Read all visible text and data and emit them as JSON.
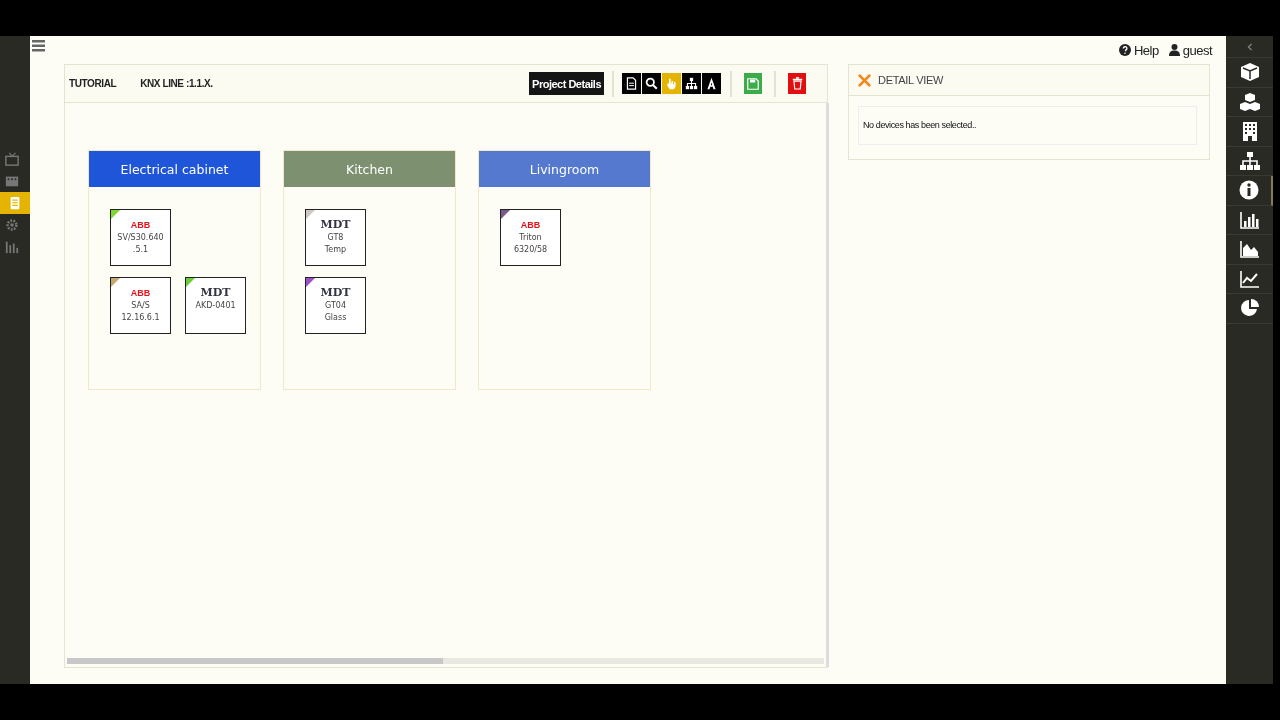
{
  "left_sidebar": [
    {
      "kind": "tv",
      "selected": false
    },
    {
      "kind": "film",
      "selected": false
    },
    {
      "kind": "document",
      "selected": true
    },
    {
      "kind": "gear",
      "selected": false
    },
    {
      "kind": "bars",
      "selected": false
    }
  ],
  "header": {
    "help": "Help",
    "user": "guest"
  },
  "project": {
    "title": "TUTORIAL",
    "line": "KNX LINE :1.1.X.",
    "details_button": "Project Details",
    "tools": [
      {
        "kind": "document",
        "selected": false
      },
      {
        "kind": "search",
        "selected": false
      },
      {
        "kind": "hand",
        "selected": true
      },
      {
        "kind": "sitemap",
        "selected": false
      },
      {
        "kind": "font",
        "selected": false
      }
    ],
    "actions": [
      {
        "kind": "save"
      },
      {
        "kind": "delete"
      }
    ]
  },
  "rooms": [
    {
      "name": "Electrical cabinet",
      "color": "#1f55d9",
      "rows": [
        [
          {
            "kind": "abb",
            "vendor": "ABB",
            "model": [
              "SV/S30.640",
              ".5.1"
            ],
            "color": "#7fd832"
          }
        ],
        [
          {
            "kind": "abb",
            "vendor": "ABB",
            "model": [
              "SA/S",
              "12.16.6.1"
            ],
            "color": "#c8a870"
          },
          {
            "kind": "mdt",
            "vendor": "MDT",
            "model": [
              "AKD-0401"
            ],
            "color": "#6ccc3a"
          }
        ]
      ]
    },
    {
      "name": "Kitchen",
      "color": "#7d9170",
      "rows": [
        [
          {
            "kind": "mdt",
            "vendor": "MDT",
            "model": [
              "GT8",
              "Temp"
            ],
            "color": "#d0c8c0"
          }
        ],
        [
          {
            "kind": "mdt",
            "vendor": "MDT",
            "model": [
              "GT04",
              "Glass"
            ],
            "color": "#9a50c8"
          }
        ]
      ]
    },
    {
      "name": "Livingroom",
      "color": "#5479cf",
      "rows": [
        [
          {
            "kind": "abb",
            "vendor": "ABB",
            "model": [
              "Triton",
              "6320/58"
            ],
            "color": "#7a5a88"
          }
        ]
      ]
    }
  ],
  "detail": {
    "title": "DETAIL VIEW",
    "message": "No devices has been selected.."
  },
  "right_sidebar": [
    {
      "kind": "chevron",
      "selected": false
    },
    {
      "kind": "cube",
      "selected": false
    },
    {
      "kind": "cubes",
      "selected": false
    },
    {
      "kind": "building",
      "selected": false
    },
    {
      "kind": "sitemap",
      "selected": false
    },
    {
      "kind": "info",
      "selected": true
    },
    {
      "kind": "bar-chart",
      "selected": false
    },
    {
      "kind": "area-chart",
      "selected": false
    },
    {
      "kind": "line-chart",
      "selected": false
    },
    {
      "kind": "pie-chart",
      "selected": false
    }
  ]
}
